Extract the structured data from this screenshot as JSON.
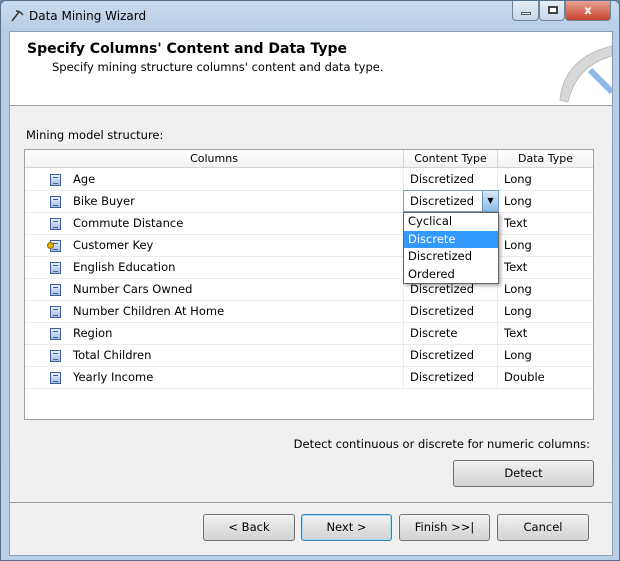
{
  "window": {
    "title": "Data Mining Wizard",
    "close_glyph": "x"
  },
  "header": {
    "title": "Specify Columns' Content and Data Type",
    "subtitle": "Specify mining structure columns' content and data type."
  },
  "structure_label": "Mining model structure:",
  "table": {
    "headers": [
      "Columns",
      "Content Type",
      "Data Type"
    ],
    "rows": [
      {
        "name": "Age",
        "content": "Discretized",
        "type": "Long",
        "icon": "column-icon"
      },
      {
        "name": "Bike Buyer",
        "content": "Discretized",
        "type": "Long",
        "icon": "column-icon"
      },
      {
        "name": "Commute Distance",
        "content": "",
        "type": "Text",
        "icon": "column-icon"
      },
      {
        "name": "Customer Key",
        "content": "",
        "type": "Long",
        "icon": "key-column-icon"
      },
      {
        "name": "English Education",
        "content": "",
        "type": "Text",
        "icon": "column-icon"
      },
      {
        "name": "Number Cars Owned",
        "content": "Discretized",
        "type": "Long",
        "icon": "column-icon"
      },
      {
        "name": "Number Children At Home",
        "content": "Discretized",
        "type": "Long",
        "icon": "column-icon"
      },
      {
        "name": "Region",
        "content": "Discrete",
        "type": "Text",
        "icon": "column-icon"
      },
      {
        "name": "Total Children",
        "content": "Discretized",
        "type": "Long",
        "icon": "column-icon"
      },
      {
        "name": "Yearly Income",
        "content": "Discretized",
        "type": "Double",
        "icon": "column-icon"
      }
    ]
  },
  "dropdown": {
    "value": "Discretized",
    "options": [
      "Cyclical",
      "Discrete",
      "Discretized",
      "Ordered"
    ],
    "highlighted": "Discrete"
  },
  "detect": {
    "label": "Detect continuous or discrete for numeric columns:",
    "button": "Detect"
  },
  "buttons": {
    "back": "< Back",
    "next": "Next >",
    "finish": "Finish >>|",
    "cancel": "Cancel"
  },
  "colors": {
    "highlight": "#3399ff",
    "title_bar": "#c8dcef"
  }
}
